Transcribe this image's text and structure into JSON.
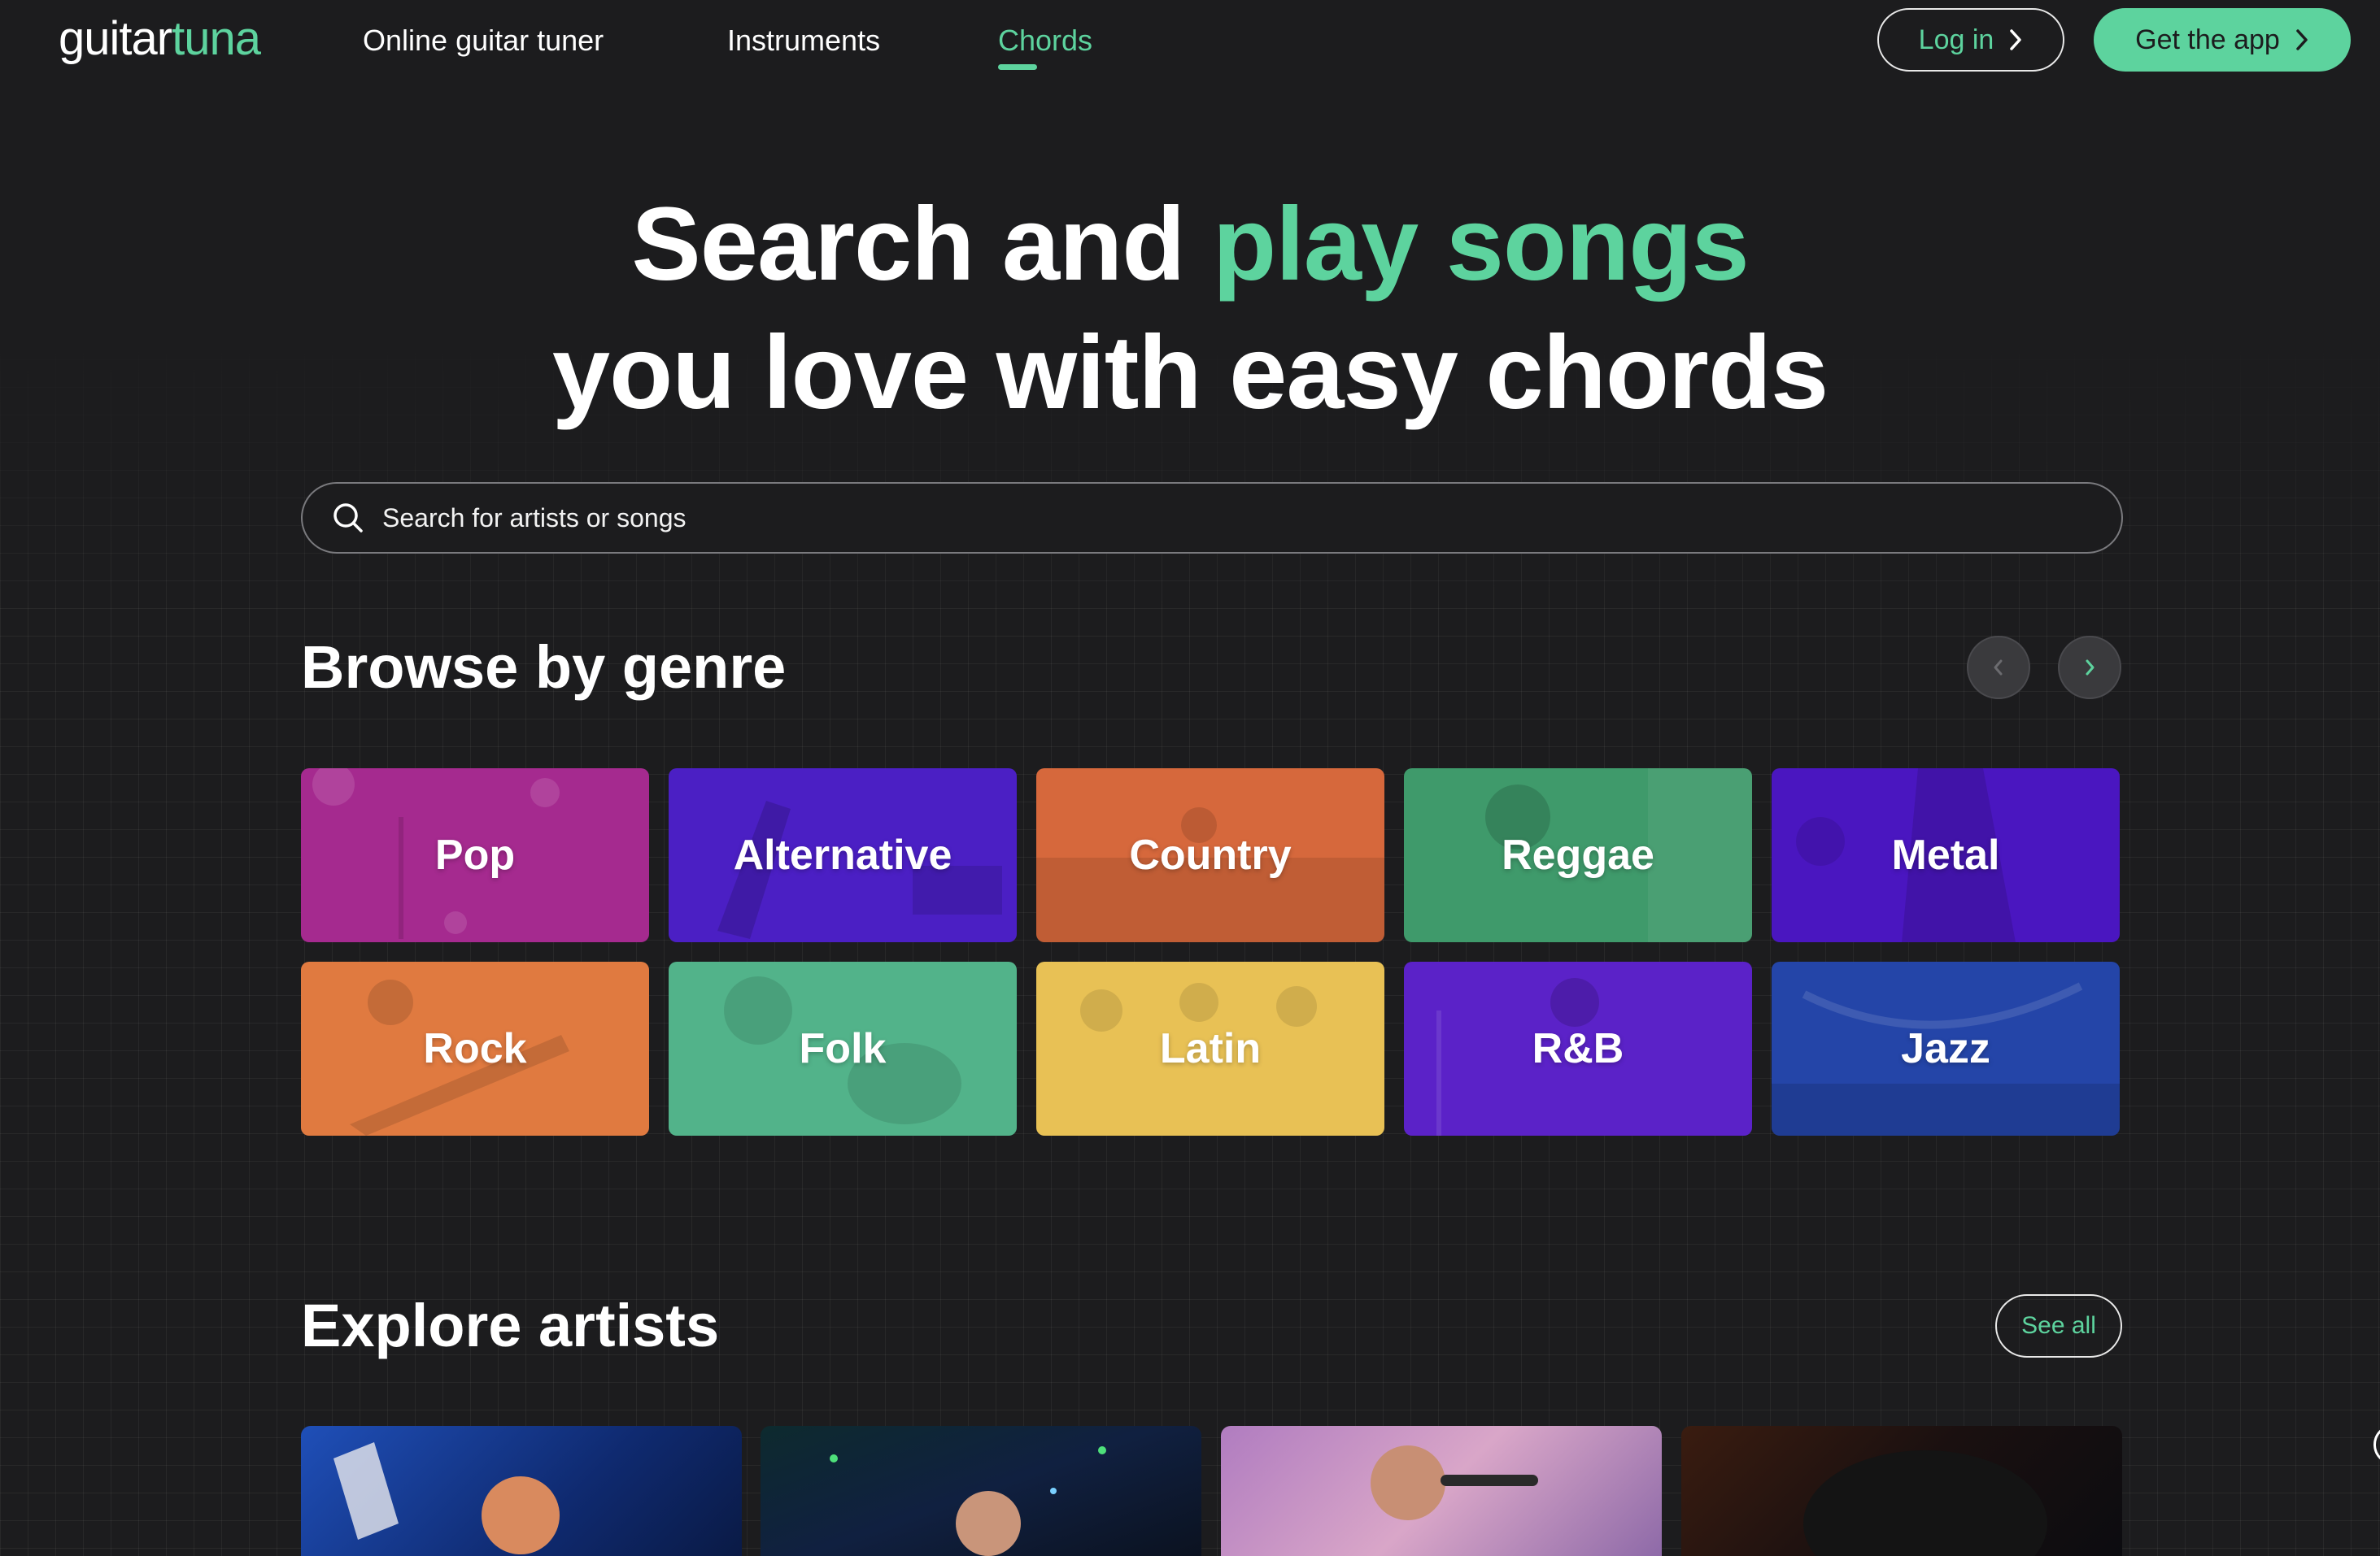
{
  "brand": {
    "part1": "guitar",
    "part2": "tuna",
    "accent": "#5dd39e"
  },
  "nav": {
    "links": [
      {
        "label": "Online guitar tuner"
      },
      {
        "label": "Instruments"
      },
      {
        "label": "Chords",
        "active": true
      }
    ],
    "login_label": "Log in",
    "get_app_label": "Get the app"
  },
  "hero": {
    "line1_start": "Search and ",
    "line1_highlight": "play songs",
    "line2": "you love with easy chords"
  },
  "search": {
    "placeholder": "Search for artists or songs",
    "value": ""
  },
  "genres_section": {
    "title": "Browse by genre",
    "prev_icon": "chevron-left-icon",
    "next_icon": "chevron-right-icon",
    "genres": [
      {
        "label": "Pop",
        "color": "#a52a8f"
      },
      {
        "label": "Alternative",
        "color": "#4b1fc4"
      },
      {
        "label": "Country",
        "color": "#d6683c"
      },
      {
        "label": "Reggae",
        "color": "#3f9a6b"
      },
      {
        "label": "Metal",
        "color": "#4a16c0"
      },
      {
        "label": "Rock",
        "color": "#e07a40"
      },
      {
        "label": "Folk",
        "color": "#52b38a"
      },
      {
        "label": "Latin",
        "color": "#e8c155"
      },
      {
        "label": "R&B",
        "color": "#5b22c8"
      },
      {
        "label": "Jazz",
        "color": "#2445a8"
      }
    ]
  },
  "artists_section": {
    "title": "Explore artists",
    "see_all_label": "See all"
  }
}
